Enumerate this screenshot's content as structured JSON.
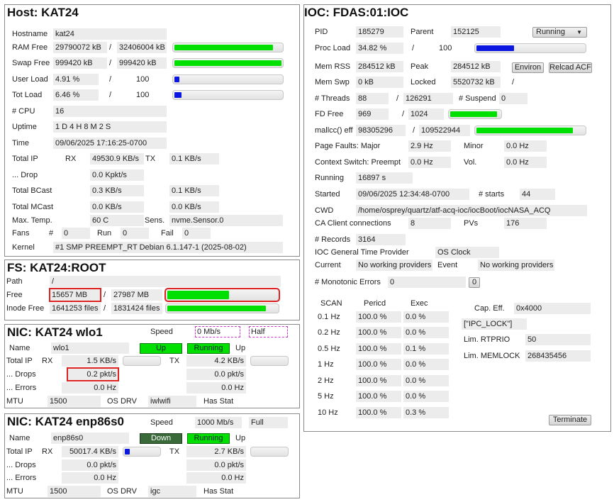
{
  "host": {
    "title": "Host: KAT24",
    "hostname_label": "Hostname",
    "hostname": "kat24",
    "ram_label": "RAM Free",
    "ram_free": "29790072 kB",
    "ram_sep": "/",
    "ram_total": "32406004 kB",
    "ram_fraction": 0.92,
    "swap_label": "Swap Free",
    "swap_free": "999420 kB",
    "swap_sep": "/",
    "swap_total": "999420 kB",
    "swap_fraction": 1.0,
    "userload_label": "User Load",
    "userload": "4.91 %",
    "userload_sep": "/",
    "userload_max": "100",
    "userload_fraction": 0.0491,
    "totload_label": "Tot Load",
    "totload": "6.46 %",
    "totload_sep": "/",
    "totload_max": "100",
    "totload_fraction": 0.0646,
    "cpu_label": "# CPU",
    "cpu": "16",
    "uptime_label": "Uptime",
    "uptime": "1 D 4 H 8 M 2 S",
    "time_label": "Time",
    "time": "09/06/2025 17:16:25-0700",
    "totalip_label": "Total IP",
    "rx_label": "RX",
    "rx": "49530.9 KB/s",
    "tx_label": "TX",
    "tx": "0.1 KB/s",
    "drop_label": "... Drop",
    "drop": "0.0 Kpkt/s",
    "bcast_label": "Total BCast",
    "bcast_rx": "0.3 KB/s",
    "bcast_tx": "0.1 KB/s",
    "mcast_label": "Total MCast",
    "mcast_rx": "0.0 KB/s",
    "mcast_tx": "0.0 KB/s",
    "temp_label": "Max. Temp.",
    "temp": "60 C",
    "sens_label": "Sens.",
    "sensor": "nvme.Sensor.0",
    "fans_label": "Fans",
    "fans_hash": "#",
    "fans_count": "0",
    "run_label": "Run",
    "run_count": "0",
    "fail_label": "Fail",
    "fail_count": "0",
    "kernel_label": "Kernel",
    "kernel": "#1 SMP PREEMPT_RT Debian 6.1.147-1 (2025-08-02)"
  },
  "fs": {
    "title": "FS: KAT24:ROOT",
    "path_label": "Path",
    "path": "/",
    "free_label": "Free",
    "free": "15657 MB",
    "free_sep": "/",
    "free_total": "27987 MB",
    "free_fraction": 0.56,
    "inode_label": "Inode Free",
    "inode_free": "1641253 files",
    "inode_sep": "/",
    "inode_total": "1831424 files",
    "inode_fraction": 0.9
  },
  "nic1": {
    "title": "NIC: KAT24 wlo1",
    "speed_label": "Speed",
    "speed": "0 Mb/s",
    "duplex": "Half",
    "name_label": "Name",
    "name": "wlo1",
    "state": "Up",
    "running": "Running",
    "up_label": "Up",
    "totalip_label": "Total IP",
    "rx_label": "RX",
    "rx": "1.5 KB/s",
    "rx_fraction": 0.0,
    "tx_label": "TX",
    "tx": "4.2 KB/s",
    "tx_fraction": 0.0,
    "drops_label": "... Drops",
    "drops_rx": "0.2 pkt/s",
    "drops_tx": "0.0 pkt/s",
    "errors_label": "... Errors",
    "errors_rx": "0.0 Hz",
    "errors_tx": "0.0 Hz",
    "mtu_label": "MTU",
    "mtu": "1500",
    "osdrv_label": "OS DRV",
    "osdrv": "iwlwifi",
    "hasstat_label": "Has Stat"
  },
  "nic2": {
    "title": "NIC: KAT24 enp86s0",
    "speed_label": "Speed",
    "speed": "1000 Mb/s",
    "duplex": "Full",
    "name_label": "Name",
    "name": "enp86s0",
    "state": "Down",
    "running": "Running",
    "up_label": "Up",
    "totalip_label": "Total IP",
    "rx_label": "RX",
    "rx": "50017.4 KB/s",
    "rx_fraction": 0.14,
    "tx_label": "TX",
    "tx": "2.7 KB/s",
    "tx_fraction": 0.0,
    "drops_label": "... Drops",
    "drops_rx": "0.0 pkt/s",
    "drops_tx": "0.0 pkt/s",
    "errors_label": "... Errors",
    "errors_rx": "0.0 Hz",
    "errors_tx": "0.0 Hz",
    "mtu_label": "MTU",
    "mtu": "1500",
    "osdrv_label": "OS DRV",
    "osdrv": "igc",
    "hasstat_label": "Has Stat"
  },
  "ioc": {
    "title": "IOC: FDAS:01:IOC",
    "pid_label": "PID",
    "pid": "185279",
    "parent_label": "Parent",
    "parent": "152125",
    "status": "Running",
    "procload_label": "Proc Load",
    "procload": "34.82 %",
    "procload_sep": "/",
    "procload_max": "100",
    "procload_fraction": 0.3482,
    "memrss_label": "Mem RSS",
    "memrss": "284512 kB",
    "peak_label": "Peak",
    "peak": "284512 kB",
    "environ_button": "Environ",
    "reload_button": "Relcad ACF",
    "memswp_label": "Mem Swp",
    "memswp": "0 kB",
    "locked_label": "Locked",
    "locked": "5520732 kB",
    "locked_sep": "/",
    "threads_label": "# Threads",
    "threads": "88",
    "threads_sep": "/",
    "threads_max": "126291",
    "suspend_label": "# Suspend",
    "suspend": "0",
    "fdfree_label": "FD Free",
    "fdfree": "969",
    "fd_sep": "/",
    "fd_max": "1024",
    "fd_fraction": 0.946,
    "malloc_label": "mallcc() eff",
    "malloc": "98305296",
    "malloc_sep": "/",
    "malloc_max": "109522944",
    "malloc_fraction": 0.898,
    "pf_label": "Page Faults: Major",
    "pf_major": "2.9 Hz",
    "minor_label": "Minor",
    "pf_minor": "0.0 Hz",
    "cs_label": "Context Switch: Preempt",
    "cs_preempt": "0.0 Hz",
    "vol_label": "Vol.",
    "cs_vol": "0.0 Hz",
    "running_label": "Running",
    "running": "16897 s",
    "started_label": "Started",
    "started": "09/06/2025 12:34:48-0700",
    "starts_label": "# starts",
    "starts": "44",
    "cwd_label": "CWD",
    "cwd": "/home/osprey/quartz/atf-acq-ioc/iocBoot/iocNASA_ACQ",
    "ca_label": "CA Client connections",
    "ca": "8",
    "pvs_label": "PVs",
    "pvs": "176",
    "records_label": "# Records",
    "records": "3164",
    "gtp_label": "IOC General Time Provider",
    "gtp": "OS Clock",
    "current_label": "Current",
    "current": "No working providers",
    "event_label": "Event",
    "event": "No working providers",
    "mono_label": "# Monotonic Errors",
    "mono": "0",
    "mono_reset": "0",
    "scan_header": "SCAN",
    "period_header": "Pericd",
    "exec_header": "Exec",
    "scan_rows": [
      {
        "rate": "0.1 Hz",
        "period": "100.0 %",
        "exec": "0.0 %"
      },
      {
        "rate": "0.2 Hz",
        "period": "100.0 %",
        "exec": "0.0 %"
      },
      {
        "rate": "0.5 Hz",
        "period": "100.0 %",
        "exec": "0.1 %"
      },
      {
        "rate": "1 Hz",
        "period": "100.0 %",
        "exec": "0.0 %"
      },
      {
        "rate": "2 Hz",
        "period": "100.0 %",
        "exec": "0.0 %"
      },
      {
        "rate": "5 Hz",
        "period": "100.0 %",
        "exec": "0.0 %"
      },
      {
        "rate": "10 Hz",
        "period": "100.0 %",
        "exec": "0.3 %"
      }
    ],
    "capeff_label": "Cap. Eff.",
    "capeff": "0x4000",
    "caps": "[\"IPC_LOCK\"]",
    "rtprio_label": "Lim. RTPRIO",
    "rtprio": "50",
    "memlock_label": "Lim. MEMLOCK",
    "memlock": "268435456",
    "terminate_button": "Terminate"
  },
  "colors": {
    "ok_green": "#00e000",
    "bar_blue": "#0b17e0",
    "alarm_red": "#d22222",
    "down_green": "#3a6a3a",
    "speed_outline": "#cc33cc"
  }
}
